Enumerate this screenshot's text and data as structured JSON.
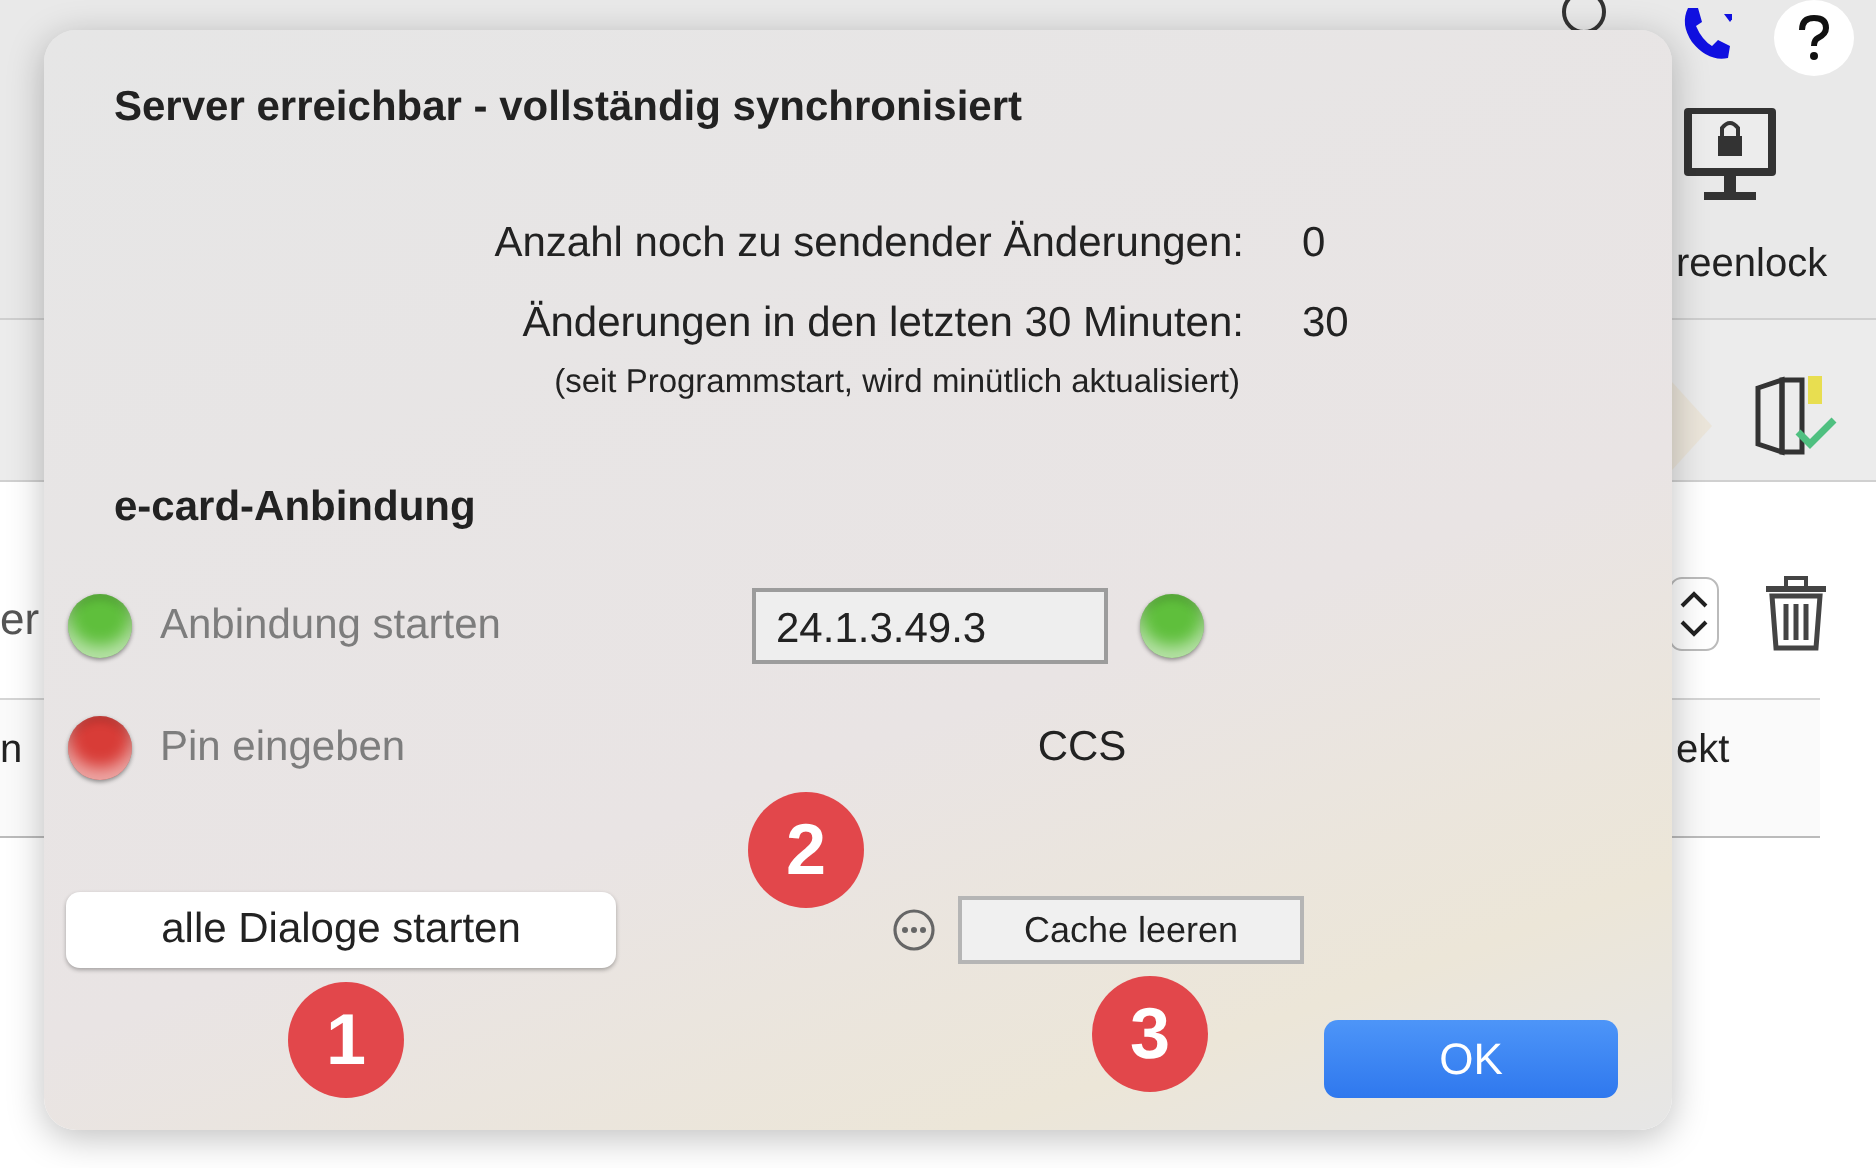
{
  "app": {
    "toolbar_label": "reenlock",
    "left_fragment": "er",
    "column_left": "n",
    "column_right": "ekt"
  },
  "popover": {
    "title": "Server erreichbar - vollständig synchronisiert",
    "stats": [
      {
        "label": "Anzahl noch zu sendender Änderungen:",
        "value": "0"
      },
      {
        "label": "Änderungen in den letzten 30 Minuten:",
        "value": "30",
        "note": "(seit Programmstart, wird minütlich aktualisiert)"
      }
    ],
    "section_title": "e-card-Anbindung",
    "connections": [
      {
        "label": "Anbindung starten",
        "color": "#5fbf3c"
      },
      {
        "label": "Pin eingeben",
        "color": "#d83c37"
      }
    ],
    "version": {
      "text": "24.1.3.49.3",
      "color": "#5fbf3c"
    },
    "mode": "CCS",
    "buttons": {
      "start_all": "alle Dialoge starten",
      "clear_cache": "Cache leeren",
      "ok": "OK"
    },
    "markers": [
      {
        "number": "1"
      },
      {
        "number": "2"
      },
      {
        "number": "3"
      }
    ]
  }
}
